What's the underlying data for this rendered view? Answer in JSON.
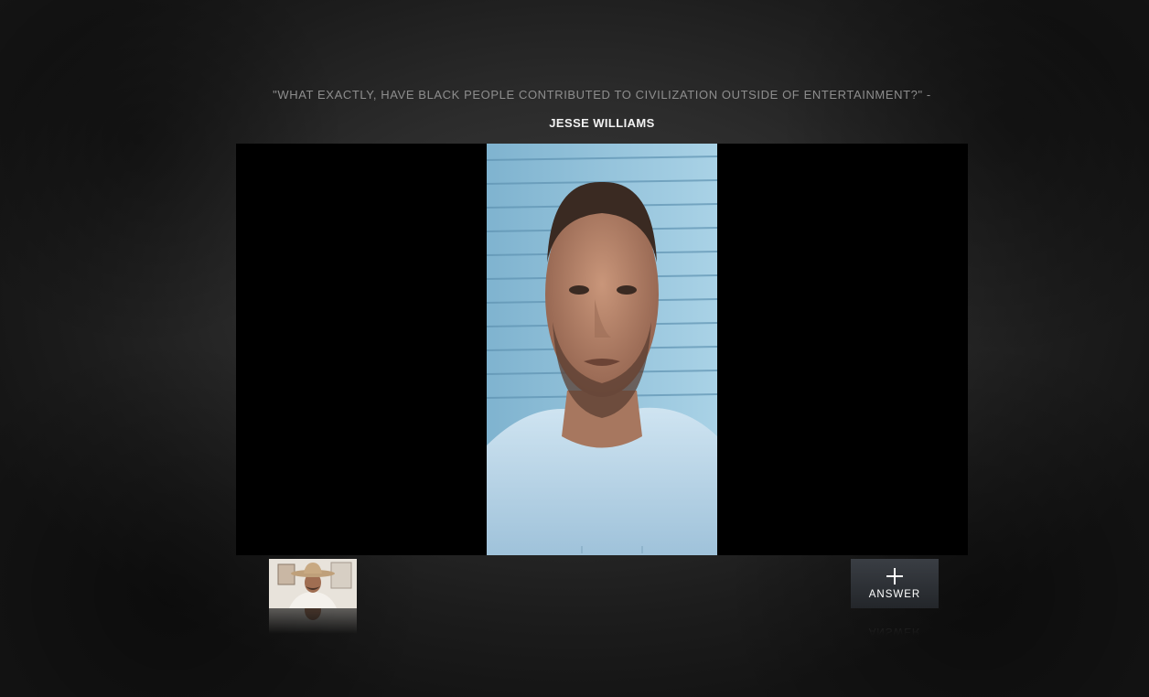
{
  "question": {
    "text": "\"WHAT EXACTLY, HAVE BLACK PEOPLE CONTRIBUTED TO CIVILIZATION OUTSIDE OF ENTERTAINMENT?\" -",
    "author": "JESSE WILLIAMS"
  },
  "video": {
    "subject": "man-in-white-tshirt-selfie-video"
  },
  "thumbnails": [
    {
      "subject": "man-in-cowboy-hat-video-thumbnail"
    }
  ],
  "answer_button": {
    "label": "ANSWER",
    "icon": "plus-icon"
  },
  "colors": {
    "background": "#2c2c2c",
    "question_text": "#8e8e8e",
    "author_text": "#f2f2f2",
    "player_bg": "#000000",
    "button_bg": "#30343a"
  }
}
